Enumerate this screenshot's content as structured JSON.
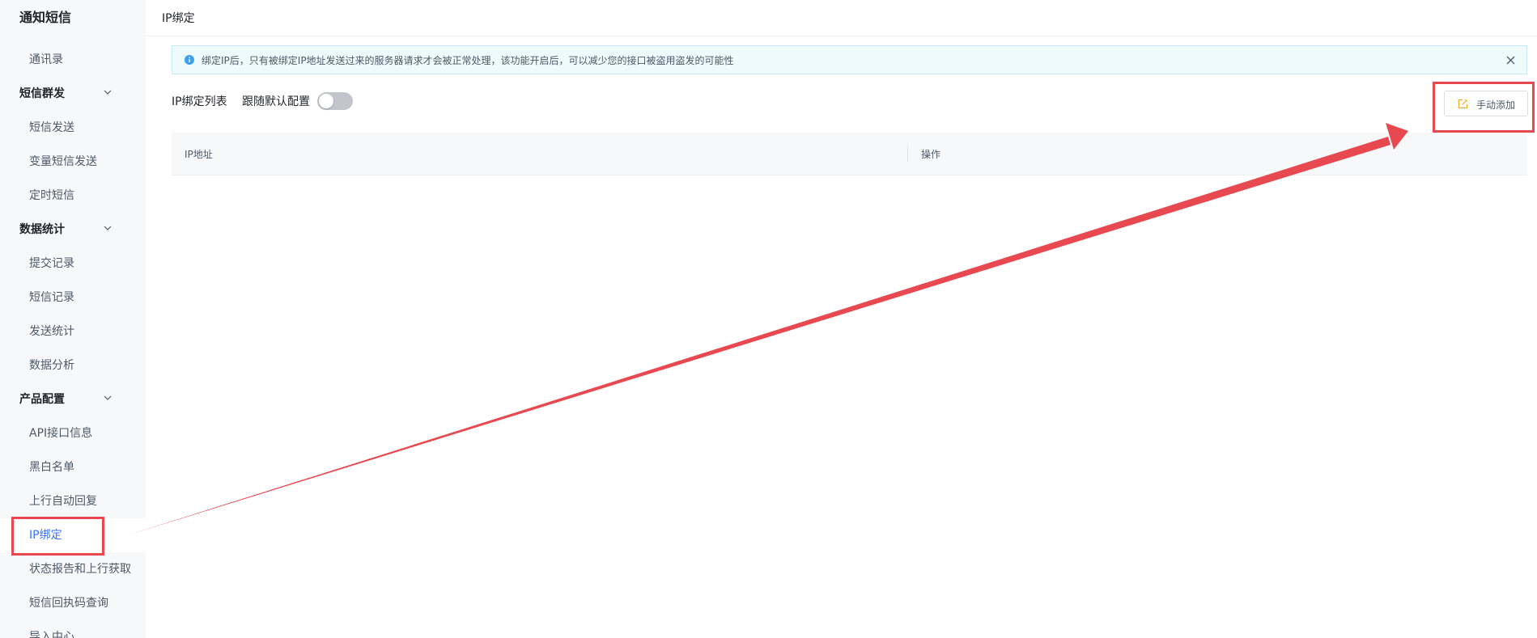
{
  "sidebar": {
    "title": "通知短信",
    "items": [
      {
        "label": "通讯录",
        "type": "item"
      },
      {
        "label": "短信群发",
        "type": "group"
      },
      {
        "label": "短信发送",
        "type": "item"
      },
      {
        "label": "变量短信发送",
        "type": "item"
      },
      {
        "label": "定时短信",
        "type": "item"
      },
      {
        "label": "数据统计",
        "type": "group"
      },
      {
        "label": "提交记录",
        "type": "item"
      },
      {
        "label": "短信记录",
        "type": "item"
      },
      {
        "label": "发送统计",
        "type": "item"
      },
      {
        "label": "数据分析",
        "type": "item"
      },
      {
        "label": "产品配置",
        "type": "group"
      },
      {
        "label": "API接口信息",
        "type": "item"
      },
      {
        "label": "黑白名单",
        "type": "item"
      },
      {
        "label": "上行自动回复",
        "type": "item"
      },
      {
        "label": "IP绑定",
        "type": "item",
        "active": true
      },
      {
        "label": "状态报告和上行获取",
        "type": "item"
      },
      {
        "label": "短信回执码查询",
        "type": "item"
      },
      {
        "label": "导入中心",
        "type": "item"
      }
    ]
  },
  "header": {
    "title": "IP绑定"
  },
  "alert": {
    "icon": "info-icon",
    "message": "绑定IP后，只有被绑定IP地址发送过来的服务器请求才会被正常处理，该功能开启后，可以减少您的接口被盗用盗发的可能性"
  },
  "toolbar": {
    "list_label": "IP绑定列表",
    "follow_label": "跟随默认配置",
    "follow_enabled": false,
    "add_button_label": "手动添加"
  },
  "table": {
    "columns": [
      "IP地址",
      "操作"
    ],
    "rows": []
  },
  "colors": {
    "accent": "#3370ff",
    "annotation": "#e8484f",
    "alert_bg": "#eefafc",
    "info_icon": "#3ba0f0",
    "edit_icon": "#f5a623"
  }
}
